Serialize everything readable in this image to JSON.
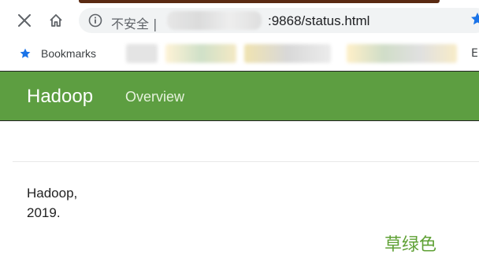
{
  "browser": {
    "security_label": "不安全 |",
    "url_tail": ":9868/status.html",
    "bookmarks_label": "Bookmarks",
    "bookmarks_overflow": "El",
    "icons": [
      "close-icon",
      "home-icon",
      "info-icon",
      "star-icon",
      "bookmark-star-icon"
    ]
  },
  "navbar": {
    "brand": "Hadoop",
    "links": [
      "Overview"
    ],
    "background": "#5d9e41"
  },
  "footer": {
    "line1": "Hadoop,",
    "line2": "2019."
  },
  "annotation": {
    "label": "草绿色",
    "color": "#5fa135"
  }
}
